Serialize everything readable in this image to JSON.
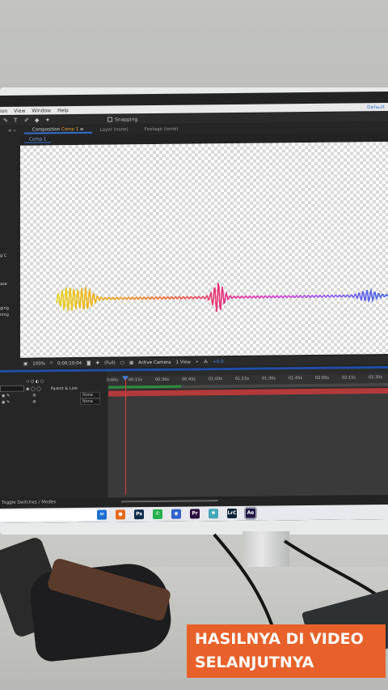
{
  "menubar": {
    "items": [
      "ion",
      "View",
      "Window",
      "Help"
    ],
    "workspace": "Default"
  },
  "toolbar": {
    "snapping_label": "Snapping"
  },
  "panels": {
    "composition_tab_prefix": "Composition",
    "composition_tab_name": "Comp 1",
    "layer_tab": "Layer (none)",
    "footage_tab": "Footage (none)",
    "comp_subtab": "Comp 1"
  },
  "left_panel": {
    "labels": [
      "g C",
      "ase",
      "ging",
      "ning"
    ]
  },
  "viewer": {
    "zoom": "100%",
    "timecode": "0;00;10;04",
    "resolution": "(Full)",
    "camera": "Active Camera",
    "views": "1 View",
    "exposure": "+0.0"
  },
  "waveform_colors": [
    "#e8d31c",
    "#f2a21a",
    "#f0642f",
    "#e52f7d",
    "#d43bd6",
    "#8a5bf0",
    "#3d62e6"
  ],
  "timeline": {
    "column_header": "Parent & Link",
    "rows": [
      {
        "parent": "None"
      },
      {
        "parent": "None"
      }
    ],
    "ruler": [
      "0:00s",
      "00:15s",
      "00:30s",
      "00:45s",
      "01:00s",
      "01:15s",
      "01:30s",
      "01:45s",
      "02:00s",
      "02:15s",
      "02:30s"
    ],
    "toggle_label": "Toggle Switches / Modes"
  },
  "taskbar": {
    "apps": [
      {
        "name": "edge-icon",
        "label": "e",
        "color": "#1f8ad9"
      },
      {
        "name": "file-explorer-icon",
        "label": "▇",
        "color": "#e8b22b"
      },
      {
        "name": "mail-icon",
        "label": "✉",
        "color": "#1c6fd1"
      },
      {
        "name": "firefox-icon",
        "label": "●",
        "color": "#e86a1c"
      },
      {
        "name": "photoshop-icon",
        "label": "Ps",
        "color": "#0d2a4a"
      },
      {
        "name": "whatsapp-icon",
        "label": "✆",
        "color": "#22b04b"
      },
      {
        "name": "browser-icon",
        "label": "◉",
        "color": "#3163c9"
      },
      {
        "name": "premiere-icon",
        "label": "Pr",
        "color": "#2a0f3e"
      },
      {
        "name": "settings-icon",
        "label": "✱",
        "color": "#44a7b8"
      },
      {
        "name": "lrc-icon",
        "label": "LrC",
        "color": "#0c2638"
      },
      {
        "name": "after-effects-icon",
        "label": "Ae",
        "color": "#1f1545"
      }
    ]
  },
  "caption": {
    "line1": "HASILNYA DI VIDEO",
    "line2": "SELANJUTNYA"
  }
}
